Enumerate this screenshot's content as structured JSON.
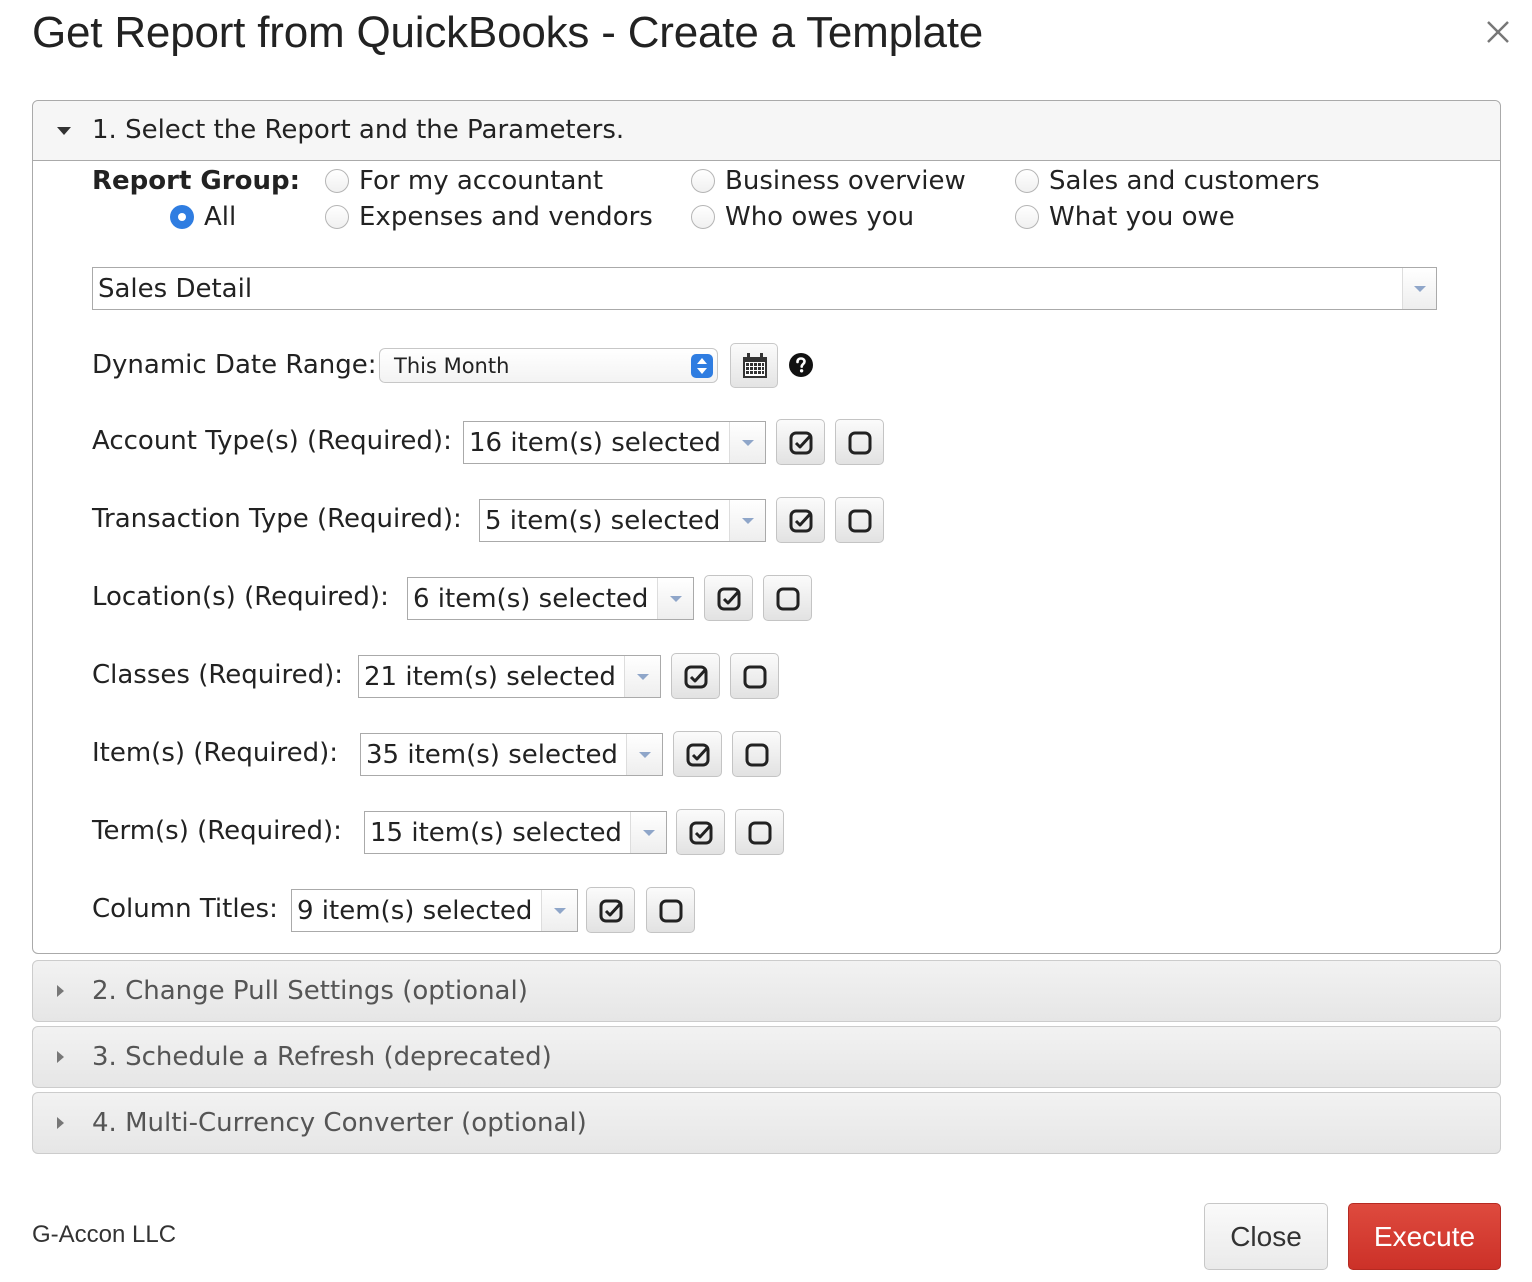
{
  "dialog": {
    "title": "Get Report from QuickBooks - Create a Template"
  },
  "sections": [
    {
      "label": "1. Select the Report and the Parameters.",
      "expanded": true
    },
    {
      "label": "2. Change Pull Settings (optional)",
      "expanded": false
    },
    {
      "label": "3. Schedule a Refresh (deprecated)",
      "expanded": false
    },
    {
      "label": "4. Multi-Currency Converter (optional)",
      "expanded": false
    }
  ],
  "report_group": {
    "label": "Report Group:",
    "selected": "All",
    "options": [
      "All",
      "For my accountant",
      "Expenses and vendors",
      "Business overview",
      "Who owes you",
      "Sales and customers",
      "What you owe"
    ]
  },
  "report": {
    "selected": "Sales Detail"
  },
  "date_range": {
    "label": "Dynamic Date Range:",
    "value": "This Month"
  },
  "params": [
    {
      "label": "Account Type(s) (Required):",
      "value": "16 item(s) selected"
    },
    {
      "label": "Transaction Type (Required):",
      "value": "5 item(s) selected"
    },
    {
      "label": "Location(s) (Required):",
      "value": "6 item(s) selected"
    },
    {
      "label": "Classes (Required):",
      "value": "21 item(s) selected"
    },
    {
      "label": "Item(s) (Required):",
      "value": "35 item(s) selected"
    },
    {
      "label": "Term(s) (Required):",
      "value": "15 item(s) selected"
    },
    {
      "label": "Column Titles:",
      "value": "9 item(s) selected"
    }
  ],
  "footer": {
    "brand": "G-Accon LLC",
    "close_label": "Close",
    "execute_label": "Execute"
  },
  "colors": {
    "accent_blue": "#2f7de1",
    "execute_red": "#cc3128"
  },
  "icons": {
    "close": "close-icon",
    "calendar": "calendar-icon",
    "help": "help-icon",
    "select_all": "check-all-icon",
    "clear_all": "clear-all-icon"
  }
}
